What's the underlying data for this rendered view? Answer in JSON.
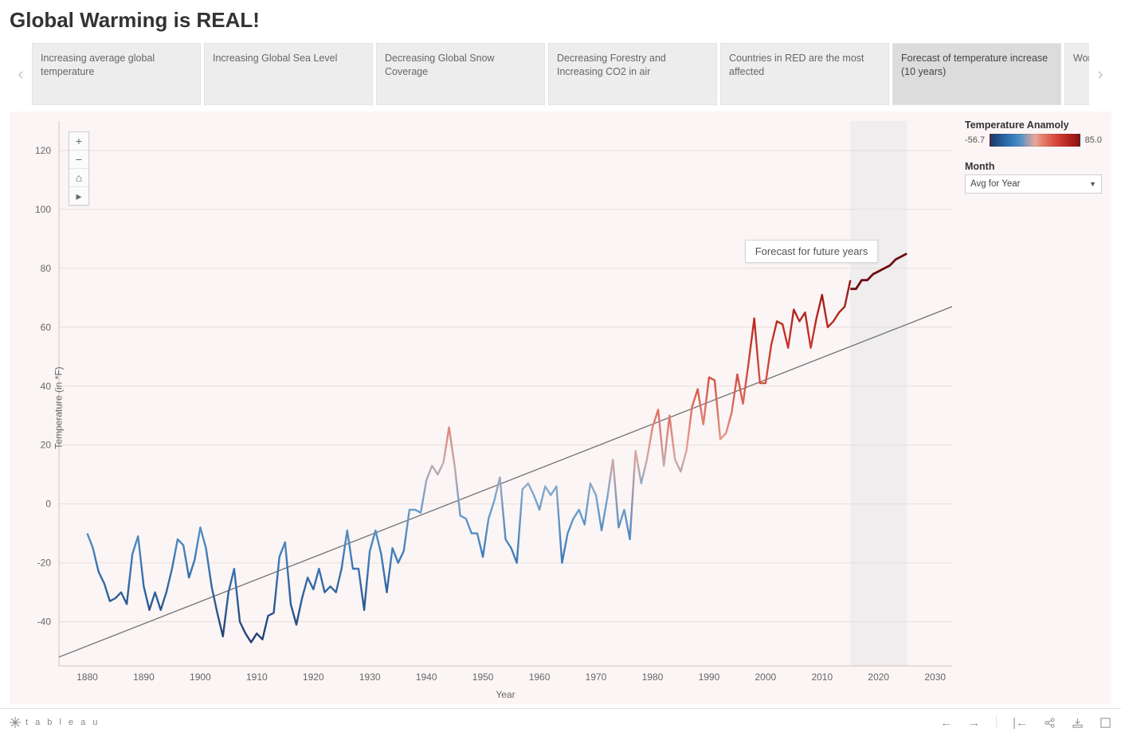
{
  "header": {
    "title": "Global Warming is REAL!"
  },
  "story": {
    "prev_label": "‹",
    "next_label": "›",
    "active_index": 5,
    "tabs": [
      "Increasing average global temperature",
      "Increasing Global Sea Level",
      "Decreasing Global Snow Coverage",
      "Decreasing Forestry and Increasing CO2 in air",
      "Countries in RED are the most affected",
      "Forecast of temperature increase (10 years)",
      "Wordcloud of tweets related to Global Warming"
    ]
  },
  "legend": {
    "title": "Temperature Anamoly",
    "min": "-56.7",
    "max": "85.0"
  },
  "filter": {
    "label": "Month",
    "value": "Avg for Year"
  },
  "annotation": {
    "text": "Forecast for future years",
    "x_year": 2009,
    "y_value": 87
  },
  "map_controls": {
    "zoom_in": "+",
    "zoom_out": "−",
    "home": "⌂",
    "tools": "▸"
  },
  "footer": {
    "logo_text": "t a b l e a u"
  },
  "chart_data": {
    "type": "line",
    "title": "",
    "xlabel": "Year",
    "ylabel": "Temperature (in *F)",
    "xlim": [
      1875,
      2033
    ],
    "ylim": [
      -55,
      130
    ],
    "y_ticks": [
      -40,
      -20,
      0,
      20,
      40,
      60,
      80,
      100,
      120
    ],
    "x_ticks": [
      1880,
      1890,
      1900,
      1910,
      1920,
      1930,
      1940,
      1950,
      1960,
      1970,
      1980,
      1990,
      2000,
      2010,
      2020,
      2030
    ],
    "trend_line": {
      "p1": [
        1875,
        -52
      ],
      "p2": [
        2033,
        67
      ]
    },
    "forecast_band": {
      "x_start": 2015,
      "x_end": 2025
    },
    "series": [
      {
        "name": "Temperature Anomaly (Actual)",
        "color_mode": "gradient",
        "x": [
          1880,
          1881,
          1882,
          1883,
          1884,
          1885,
          1886,
          1887,
          1888,
          1889,
          1890,
          1891,
          1892,
          1893,
          1894,
          1895,
          1896,
          1897,
          1898,
          1899,
          1900,
          1901,
          1902,
          1903,
          1904,
          1905,
          1906,
          1907,
          1908,
          1909,
          1910,
          1911,
          1912,
          1913,
          1914,
          1915,
          1916,
          1917,
          1918,
          1919,
          1920,
          1921,
          1922,
          1923,
          1924,
          1925,
          1926,
          1927,
          1928,
          1929,
          1930,
          1931,
          1932,
          1933,
          1934,
          1935,
          1936,
          1937,
          1938,
          1939,
          1940,
          1941,
          1942,
          1943,
          1944,
          1945,
          1946,
          1947,
          1948,
          1949,
          1950,
          1951,
          1952,
          1953,
          1954,
          1955,
          1956,
          1957,
          1958,
          1959,
          1960,
          1961,
          1962,
          1963,
          1964,
          1965,
          1966,
          1967,
          1968,
          1969,
          1970,
          1971,
          1972,
          1973,
          1974,
          1975,
          1976,
          1977,
          1978,
          1979,
          1980,
          1981,
          1982,
          1983,
          1984,
          1985,
          1986,
          1987,
          1988,
          1989,
          1990,
          1991,
          1992,
          1993,
          1994,
          1995,
          1996,
          1997,
          1998,
          1999,
          2000,
          2001,
          2002,
          2003,
          2004,
          2005,
          2006,
          2007,
          2008,
          2009,
          2010,
          2011,
          2012,
          2013,
          2014,
          2015
        ],
        "values": [
          -10,
          -15,
          -23,
          -27,
          -33,
          -32,
          -30,
          -34,
          -17,
          -11,
          -28,
          -36,
          -30,
          -36,
          -30,
          -22,
          -12,
          -14,
          -25,
          -19,
          -8,
          -15,
          -28,
          -37,
          -45,
          -30,
          -22,
          -40,
          -44,
          -47,
          -44,
          -46,
          -38,
          -37,
          -18,
          -13,
          -34,
          -41,
          -32,
          -25,
          -29,
          -22,
          -30,
          -28,
          -30,
          -22,
          -9,
          -22,
          -22,
          -36,
          -16,
          -9,
          -17,
          -30,
          -15,
          -20,
          -16,
          -2,
          -2,
          -3,
          8,
          13,
          10,
          14,
          26,
          13,
          -4,
          -5,
          -10,
          -10,
          -18,
          -5,
          1,
          9,
          -12,
          -15,
          -20,
          5,
          7,
          3,
          -2,
          6,
          3,
          6,
          -20,
          -10,
          -5,
          -2,
          -7,
          7,
          3,
          -9,
          2,
          15,
          -8,
          -2,
          -12,
          18,
          7,
          15,
          26,
          32,
          13,
          30,
          15,
          11,
          18,
          33,
          39,
          27,
          43,
          42,
          22,
          24,
          31,
          44,
          34,
          48,
          63,
          41,
          41,
          54,
          62,
          61,
          53,
          66,
          62,
          65,
          53,
          63,
          71,
          60,
          62,
          65,
          67,
          76
        ]
      },
      {
        "name": "Forecast",
        "color_mode": "forecast",
        "x": [
          2015,
          2016,
          2017,
          2018,
          2019,
          2020,
          2021,
          2022,
          2023,
          2024,
          2025
        ],
        "values": [
          73,
          73,
          76,
          76,
          78,
          79,
          80,
          81,
          83,
          84,
          85
        ]
      }
    ]
  }
}
